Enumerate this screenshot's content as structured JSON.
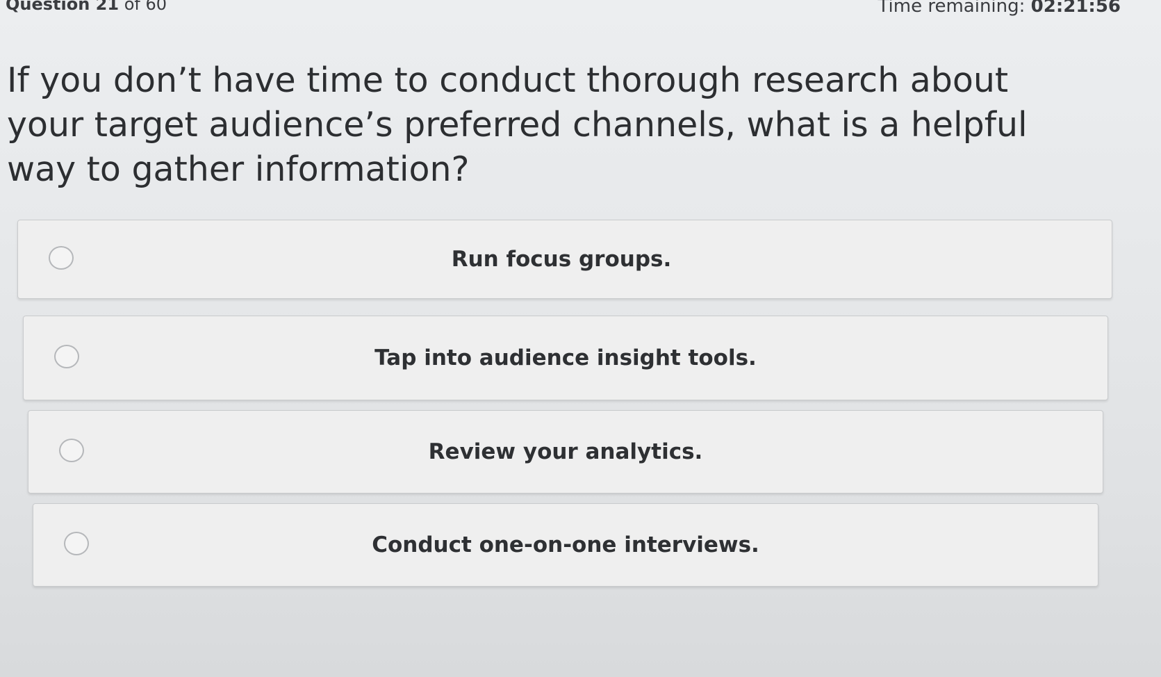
{
  "header": {
    "progress_strong": "Question 21",
    "progress_rest": " of 60",
    "timer_label": "Time remaining: ",
    "timer_value": "02:21:56"
  },
  "question": {
    "text": "If you don’t have time to conduct thorough research about your target audience’s preferred channels, what is a helpful way to gather information?"
  },
  "options": [
    {
      "label": "Run focus groups.",
      "selected": false
    },
    {
      "label": "Tap into audience insight tools.",
      "selected": false
    },
    {
      "label": "Review your analytics.",
      "selected": false
    },
    {
      "label": "Conduct one-on-one interviews.",
      "selected": false
    }
  ],
  "icons": {
    "radio": "radio-unchecked-icon"
  }
}
